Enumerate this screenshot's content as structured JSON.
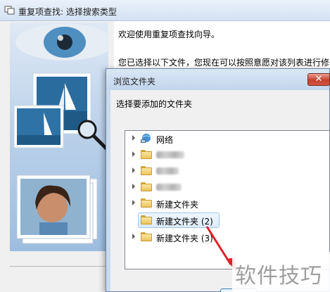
{
  "wizard": {
    "title": "重复项查找: 选择搜索类型",
    "welcome": "欢迎使用重复项查找向导。",
    "intro": "您已选择以下文件，您现在可以按照意愿对该列表进行修改"
  },
  "dialog": {
    "title": "浏览文件夹",
    "close_label": "✕",
    "instruction": "选择要添加的文件夹",
    "tree": [
      {
        "label": "网络",
        "icon": "network-icon"
      },
      {
        "label": "",
        "icon": "folder-icon",
        "blurred": true
      },
      {
        "label": "",
        "icon": "folder-icon",
        "blurred": true
      },
      {
        "label": "",
        "icon": "folder-icon",
        "blurred": true
      },
      {
        "label": "新建文件夹",
        "icon": "folder-icon"
      },
      {
        "label": "新建文件夹 (2)",
        "icon": "folder-icon",
        "selected": true
      },
      {
        "label": "新建文件夹 (3)",
        "icon": "folder-icon"
      }
    ]
  },
  "watermark": "软件技巧",
  "colors": {
    "accent": "#9fc3e8",
    "close": "#c7402d",
    "arrow": "#e0202a"
  }
}
